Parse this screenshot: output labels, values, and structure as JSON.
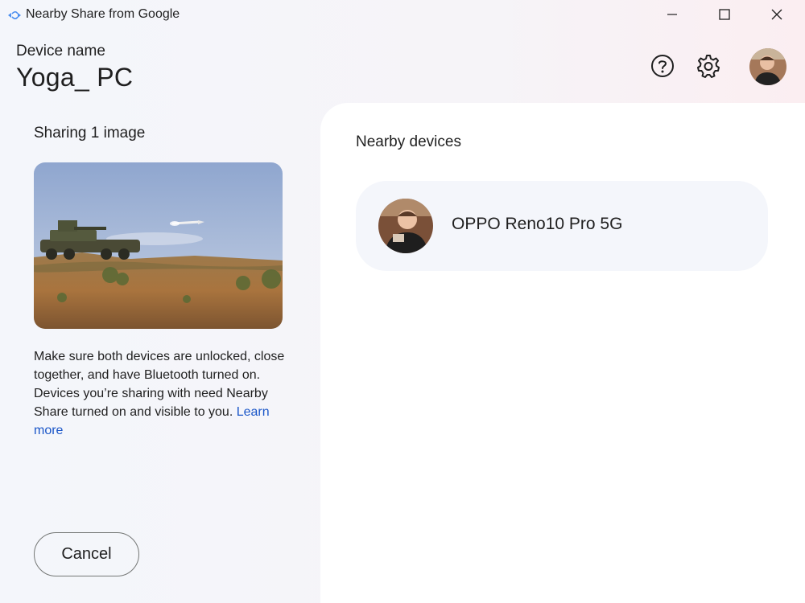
{
  "window": {
    "title": "Nearby Share from Google",
    "controls": {
      "minimize_icon": "minimize-icon",
      "maximize_icon": "maximize-icon",
      "close_icon": "close-icon"
    }
  },
  "header": {
    "device_label": "Device name",
    "device_name": "Yoga_ PC",
    "icons": [
      "help-icon",
      "settings-gear-icon",
      "account-avatar"
    ]
  },
  "sharing": {
    "label": "Sharing 1 image",
    "info_text": "Make sure both devices are unlocked, close together, and have Bluetooth turned on. Devices you’re sharing with need Nearby Share turned on and visible to you.",
    "learn_more": "Learn more",
    "cancel_label": "Cancel"
  },
  "nearby": {
    "label": "Nearby devices",
    "devices": [
      {
        "name": "OPPO Reno10 Pro 5G"
      }
    ]
  },
  "colors": {
    "accent_link": "#1a56c8",
    "panel_bg": "#ffffff",
    "card_bg": "#f4f6fb",
    "text": "#1f1f1f"
  }
}
